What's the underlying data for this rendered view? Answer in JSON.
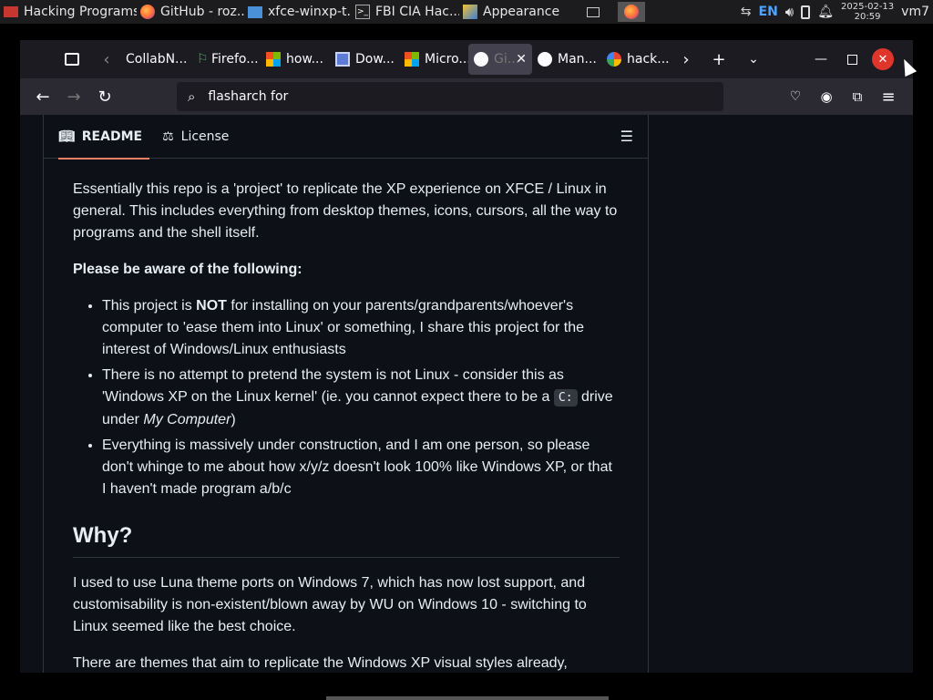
{
  "taskbar": {
    "tasks": [
      {
        "label": "Hacking Programs"
      },
      {
        "label": "GitHub - roz..."
      },
      {
        "label": "xfce-winxp-t..."
      },
      {
        "label": "FBI CIA Hac..."
      },
      {
        "label": "Appearance"
      }
    ],
    "language": "EN",
    "date": "2025-02-13",
    "time": "20:59",
    "user": "vm7"
  },
  "browser": {
    "tabs": [
      {
        "label": "CollabN..."
      },
      {
        "label": "Firefo..."
      },
      {
        "label": "how..."
      },
      {
        "label": "Dow..."
      },
      {
        "label": "Micro..."
      },
      {
        "label": "Gi..."
      },
      {
        "label": "Man..."
      },
      {
        "label": "hack..."
      }
    ],
    "address": "flasharch for"
  },
  "readme": {
    "tab_readme": "README",
    "tab_license": "License",
    "intro": "Essentially this repo is a 'project' to replicate the XP experience on XFCE / Linux in general. This includes everything from desktop themes, icons, cursors, all the way to programs and the shell itself.",
    "aware": "Please be aware of the following:",
    "b1_pre": "This project is ",
    "b1_bold": "NOT",
    "b1_post": " for installing on your parents/grandparents/whoever's computer to 'ease them into Linux' or something, I share this project for the interest of Windows/Linux enthusiasts",
    "b2_pre": "There is no attempt to pretend the system is not Linux - consider this as 'Windows XP on the Linux kernel' (ie. you cannot expect there to be a ",
    "b2_code": "C:",
    "b2_mid": " drive under ",
    "b2_em": "My Computer",
    "b2_post": ")",
    "b3": "Everything is massively under construction, and I am one person, so please don't whinge to me about how x/y/z doesn't look 100% like Windows XP, or that I haven't made program a/b/c",
    "why_heading": "Why?",
    "why_p1": "I used to use Luna theme ports on Windows 7, which has now lost support, and customisability is non-existent/blown away by WU on Windows 10 - switching to Linux seemed like the best choice.",
    "why_p2": "There are themes that aim to replicate the Windows XP visual styles already,"
  },
  "colors": {
    "bg": "#0d1117",
    "text": "#e6edf3",
    "border": "#30363d",
    "tab_underline": "#f78166",
    "close_btn": "#e0352b"
  }
}
